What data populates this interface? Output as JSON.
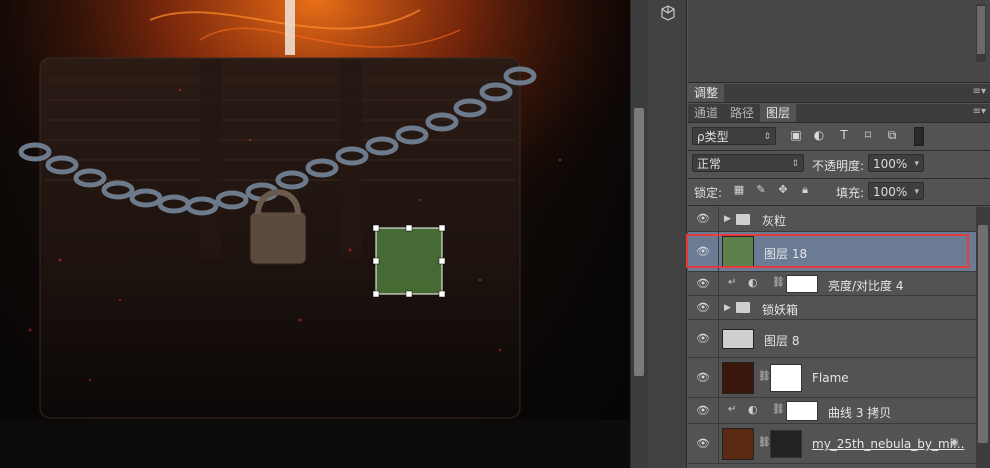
{
  "toolstrip": {
    "cube_icon": "3d-cube-icon"
  },
  "panels": {
    "adjust_tab": "调整",
    "tabs": [
      "通道",
      "路径",
      "图层"
    ],
    "active_tab": "图层",
    "filter": {
      "kind_label": "ρ类型"
    },
    "blend": {
      "mode": "正常",
      "opacity_label": "不透明度:",
      "opacity": "100%"
    },
    "lock": {
      "label": "锁定:",
      "fill_label": "填充:",
      "fill": "100%"
    }
  },
  "layers": [
    {
      "name": "灰粒",
      "type": "group"
    },
    {
      "name": "图层 18",
      "type": "layer",
      "selected": true
    },
    {
      "name": "亮度/对比度 4",
      "type": "adjustment"
    },
    {
      "name": "锁妖箱",
      "type": "group"
    },
    {
      "name": "图层 8",
      "type": "layer"
    },
    {
      "name": "Flame",
      "type": "masked"
    },
    {
      "name": "曲线 3 拷贝",
      "type": "adjustment"
    },
    {
      "name": "my_25th_nebula_by_mi...",
      "type": "masked"
    }
  ],
  "colors": {
    "selection": "#6b7b94",
    "highlight_box": "#e83a3a",
    "panel_bg": "#535353"
  }
}
